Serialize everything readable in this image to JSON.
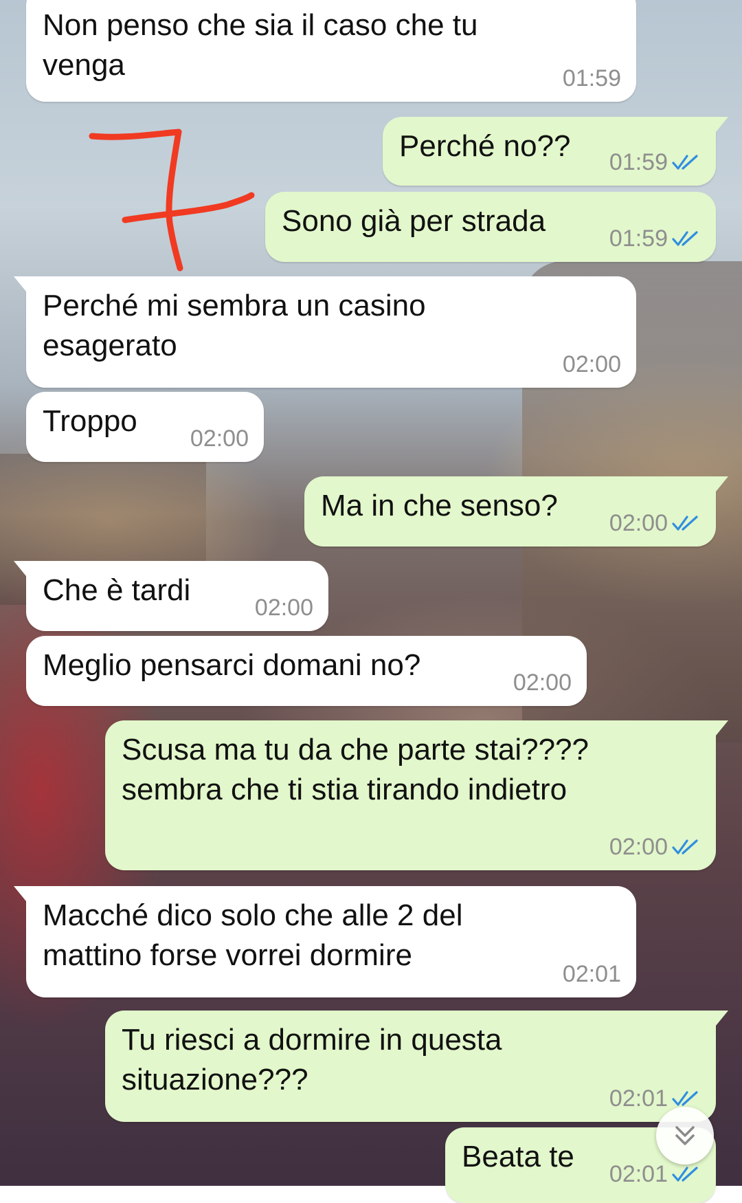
{
  "theme": {
    "incoming_bubble": "#ffffff",
    "outgoing_bubble": "#e2f7cb",
    "read_tick": "#2f8ee0",
    "annotation": "#f03a22"
  },
  "messages": [
    {
      "direction": "incoming",
      "text": "Non penso che sia il caso che tu\nvenga",
      "time": "01:59"
    },
    {
      "direction": "outgoing",
      "text": "Perché no??",
      "time": "01:59",
      "status": "read"
    },
    {
      "direction": "outgoing",
      "text": "Sono già per strada",
      "time": "01:59",
      "status": "read"
    },
    {
      "direction": "incoming",
      "text": "Perché mi sembra un casino\nesagerato",
      "time": "02:00"
    },
    {
      "direction": "incoming",
      "text": "Troppo",
      "time": "02:00"
    },
    {
      "direction": "outgoing",
      "text": "Ma in che senso?",
      "time": "02:00",
      "status": "read"
    },
    {
      "direction": "incoming",
      "text": "Che è tardi",
      "time": "02:00"
    },
    {
      "direction": "incoming",
      "text": "Meglio pensarci domani no?",
      "time": "02:00"
    },
    {
      "direction": "outgoing",
      "text": "Scusa ma tu da che parte stai????\nsembra che ti stia tirando indietro",
      "time": "02:00",
      "status": "read"
    },
    {
      "direction": "incoming",
      "text": "Macché dico solo che alle 2 del\nmattino forse vorrei dormire",
      "time": "02:01"
    },
    {
      "direction": "outgoing",
      "text": "Tu riesci a dormire in questa\nsituazione???",
      "time": "02:01",
      "status": "read"
    },
    {
      "direction": "outgoing",
      "text": "Beata te",
      "time": "02:01",
      "status": "read"
    }
  ],
  "icons": {
    "read_receipt": "double-check-icon",
    "scroll_down": "double-chevron-down-icon"
  }
}
